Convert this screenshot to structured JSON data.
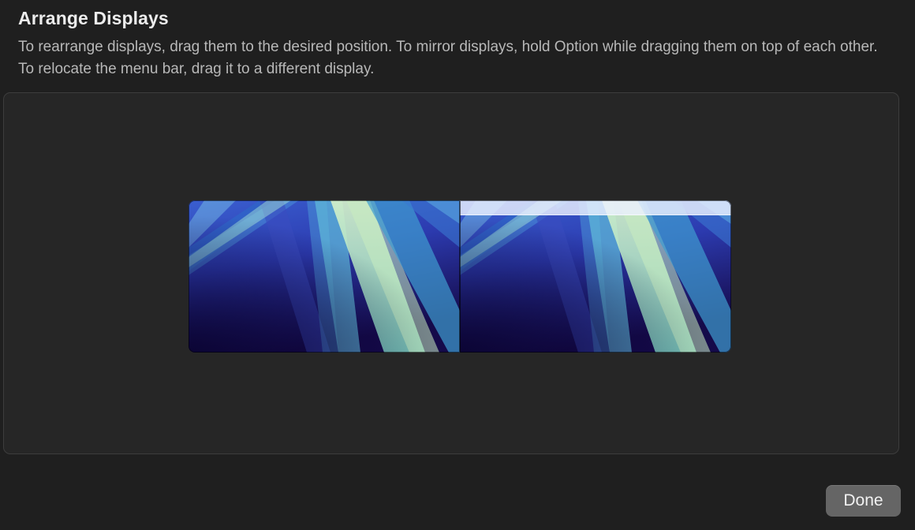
{
  "dialog": {
    "title": "Arrange Displays",
    "description": "To rearrange displays, drag them to the desired position. To mirror displays, hold Option while dragging them on top of each other. To relocate the menu bar, drag it to a different display."
  },
  "displays": [
    {
      "name": "display-1",
      "has_menu_bar": false,
      "wallpaper": "blue-light-rays-wallpaper"
    },
    {
      "name": "display-2",
      "has_menu_bar": true,
      "wallpaper": "blue-light-rays-wallpaper"
    }
  ],
  "footer": {
    "done_label": "Done"
  },
  "colors": {
    "background": "#1f1f1f",
    "panel": "#262626",
    "button": "#656565",
    "menu_bar": "#ebf0ff"
  }
}
